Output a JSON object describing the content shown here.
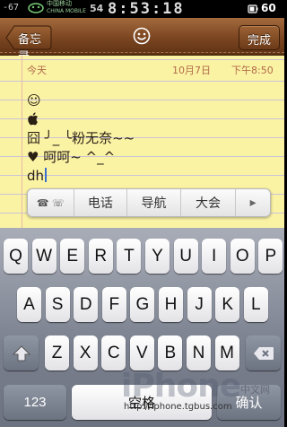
{
  "status_bar": {
    "signal": "-67",
    "carrier": "中国移动",
    "carrier_sub": "CHINA MOBILE",
    "network": "54",
    "time": "8:53:18",
    "battery": "60"
  },
  "toolbar": {
    "back_label": "备忘录",
    "title_icon": "smiley-icon",
    "done_label": "完成"
  },
  "note": {
    "date_label": "今天",
    "date": "10月7日",
    "time": "下午8:50",
    "lines": {
      "l0": "☺",
      "l2": "囧 ╯_ ╰粉无奈~~",
      "l3": "♥ 呵呵~ ^_^",
      "l4": "dh"
    }
  },
  "candidates": {
    "c0": "☎ ☏",
    "c1": "电话",
    "c2": "导航",
    "c3": "大会",
    "c4": "▸"
  },
  "keyboard": {
    "row1": [
      "Q",
      "W",
      "E",
      "R",
      "T",
      "Y",
      "U",
      "I",
      "O",
      "P"
    ],
    "row2": [
      "A",
      "S",
      "D",
      "F",
      "G",
      "H",
      "J",
      "K",
      "L"
    ],
    "row3": [
      "Z",
      "X",
      "C",
      "V",
      "B",
      "N",
      "M"
    ],
    "num_label": "123",
    "space_label": "空格",
    "return_label": "确认"
  },
  "watermark": {
    "brand": "iPhone",
    "url": "http://iphone.tgbus.com",
    "cn": "中文网"
  }
}
